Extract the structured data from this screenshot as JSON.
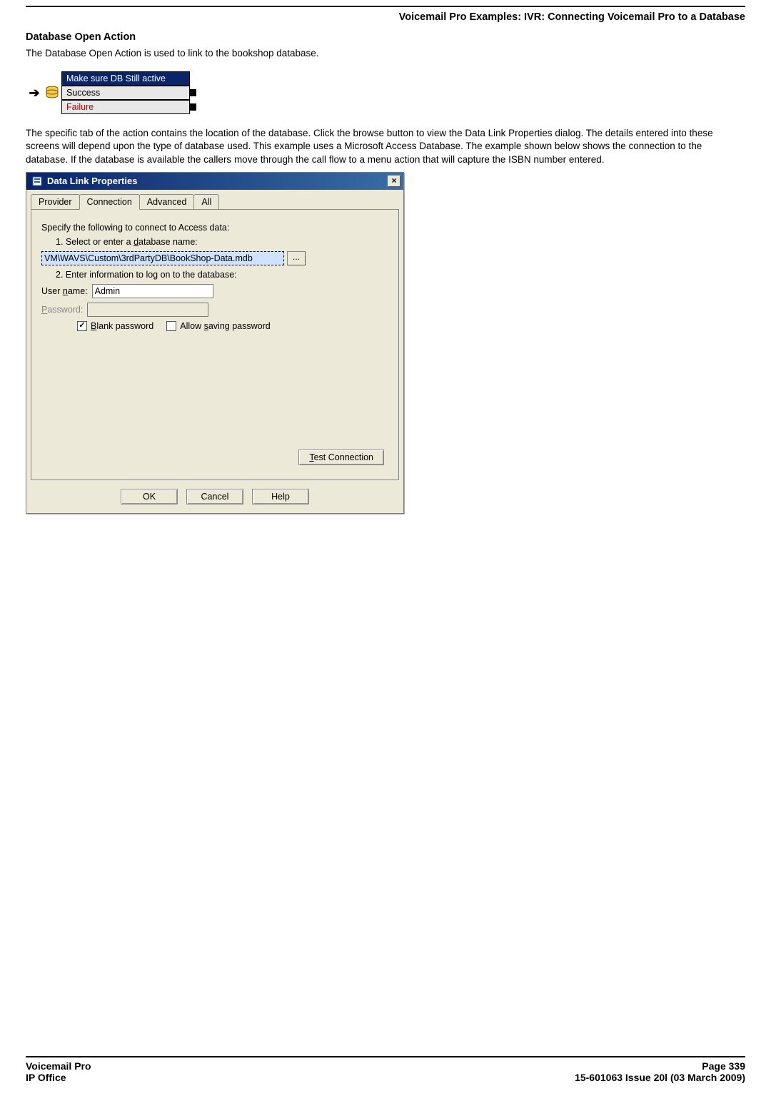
{
  "header": {
    "breadcrumb": "Voicemail Pro Examples: IVR: Connecting Voicemail Pro to a Database"
  },
  "section": {
    "title": "Database Open Action",
    "intro": "The Database Open Action is used to link to the bookshop database.",
    "paragraph": "The specific tab of the action contains the location of the database. Click the browse button to view the Data Link Properties dialog. The details entered into these screens will depend upon the type of database used. This example uses a Microsoft Access Database. The example shown below shows the connection to the database. If the database is available the callers move through the call flow to a menu action that will capture the ISBN number entered."
  },
  "flowchart": {
    "header": "Make sure DB Still active",
    "row1": "Success",
    "row2": "Failure",
    "arrow": "➔"
  },
  "dialog": {
    "title": "Data Link Properties",
    "close": "×",
    "tabs": {
      "provider": "Provider",
      "connection": "Connection",
      "advanced": "Advanced",
      "all": "All"
    },
    "specify": "Specify the following to connect to Access data:",
    "step1_label_before": "1. Select or enter a ",
    "step1_label_ul": "d",
    "step1_label_after": "atabase name:",
    "db_value": "VM\\WAVS\\Custom\\3rdPartyDB\\BookShop-Data.mdb",
    "browse": "...",
    "step2": "2. Enter information to log on to the database:",
    "user_label_before": "User ",
    "user_label_ul": "n",
    "user_label_after": "ame:",
    "user_value": "Admin",
    "pwd_label_ul": "P",
    "pwd_label_after": "assword:",
    "pwd_value": "",
    "chk_blank_ul": "B",
    "chk_blank_after": "lank password",
    "chk_save_before": "Allow ",
    "chk_save_ul": "s",
    "chk_save_after": "aving password",
    "test_ul": "T",
    "test_after": "est Connection",
    "ok": "OK",
    "cancel": "Cancel",
    "help": "Help"
  },
  "footer": {
    "left1": "Voicemail Pro",
    "left2": "IP Office",
    "right1": "Page 339",
    "right2": "15-601063 Issue 20l (03 March 2009)"
  }
}
